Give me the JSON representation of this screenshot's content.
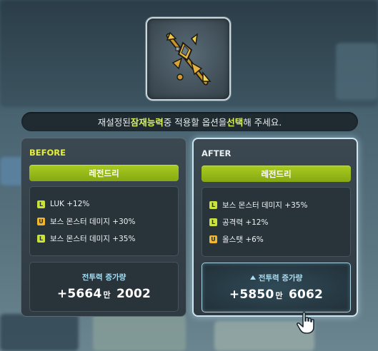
{
  "prompt": {
    "before": "재설정된 ",
    "highlight1": "잠재능력",
    "middle": " 중 적용할 옵션을 ",
    "highlight2": "선택",
    "after": "해 주세요."
  },
  "before_panel": {
    "title": "BEFORE",
    "grade": "레전드리",
    "stats": [
      {
        "badge": "L",
        "text": "LUK +12%"
      },
      {
        "badge": "U",
        "text": "보스 몬스터 데미지 +30%"
      },
      {
        "badge": "L",
        "text": "보스 몬스터 데미지 +35%"
      }
    ],
    "power_label": "전투력 증가량",
    "power_main": "+5664",
    "power_unit": "만",
    "power_rest": "2002"
  },
  "after_panel": {
    "title": "AFTER",
    "grade": "레전드리",
    "stats": [
      {
        "badge": "L",
        "text": "보스 몬스터 데미지 +35%"
      },
      {
        "badge": "L",
        "text": "공격력 +12%"
      },
      {
        "badge": "U",
        "text": "올스탯 +6%"
      }
    ],
    "power_label": "전투력 증가량",
    "power_main": "+5850",
    "power_unit": "만",
    "power_rest": "6062"
  },
  "colors": {
    "highlight": "#d9f35a",
    "grade_green": "#9fc21c",
    "legendary_badge": "#c9e33a",
    "unique_badge": "#f1b62b",
    "power_label": "#a9dff4"
  },
  "icons": {
    "item": "weapon-item-icon",
    "cursor": "hand-pointer-icon",
    "increase": "triangle-up-icon"
  }
}
